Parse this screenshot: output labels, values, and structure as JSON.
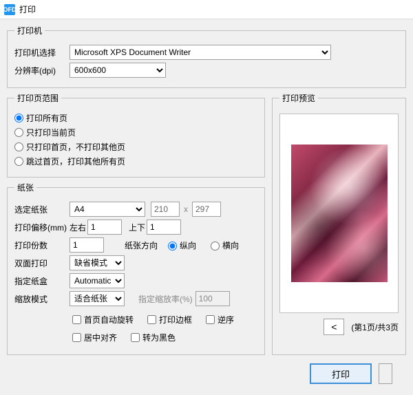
{
  "window": {
    "title": "打印"
  },
  "printer": {
    "legend": "打印机",
    "select_label": "打印机选择",
    "selected": "Microsoft XPS Document Writer",
    "dpi_label": "分辨率(dpi)",
    "dpi_value": "600x600"
  },
  "range": {
    "legend": "打印页范围",
    "opt_all": "打印所有页",
    "opt_current": "只打印当前页",
    "opt_first": "只打印首页，不打印其他页",
    "opt_skip": "跳过首页，打印其他所有页"
  },
  "paper": {
    "legend": "纸张",
    "size_label": "选定纸张",
    "size_value": "A4",
    "width": "210",
    "height": "297",
    "x_sep": "x",
    "offset_label": "打印偏移(mm)",
    "lr_label": "左右",
    "lr_value": "1",
    "ud_label": "上下",
    "ud_value": "1",
    "copies_label": "打印份数",
    "copies_value": "1",
    "orient_label": "纸张方向",
    "orient_portrait": "纵向",
    "orient_landscape": "横向",
    "duplex_label": "双面打印",
    "duplex_value": "缺省模式",
    "bin_label": "指定纸盒",
    "bin_value": "Automatic",
    "scale_label": "缩放模式",
    "scale_value": "适合纸张",
    "scale_pct_label": "指定缩放率(%)",
    "scale_pct_value": "100",
    "chk_autorotate": "首页自动旋转",
    "chk_border": "打印边框",
    "chk_reverse": "逆序",
    "chk_center": "居中对齐",
    "chk_black": "转为黑色"
  },
  "preview": {
    "legend": "打印预览",
    "prev": "<",
    "page_info": "(第1页/共3页"
  },
  "buttons": {
    "print": "打印"
  }
}
